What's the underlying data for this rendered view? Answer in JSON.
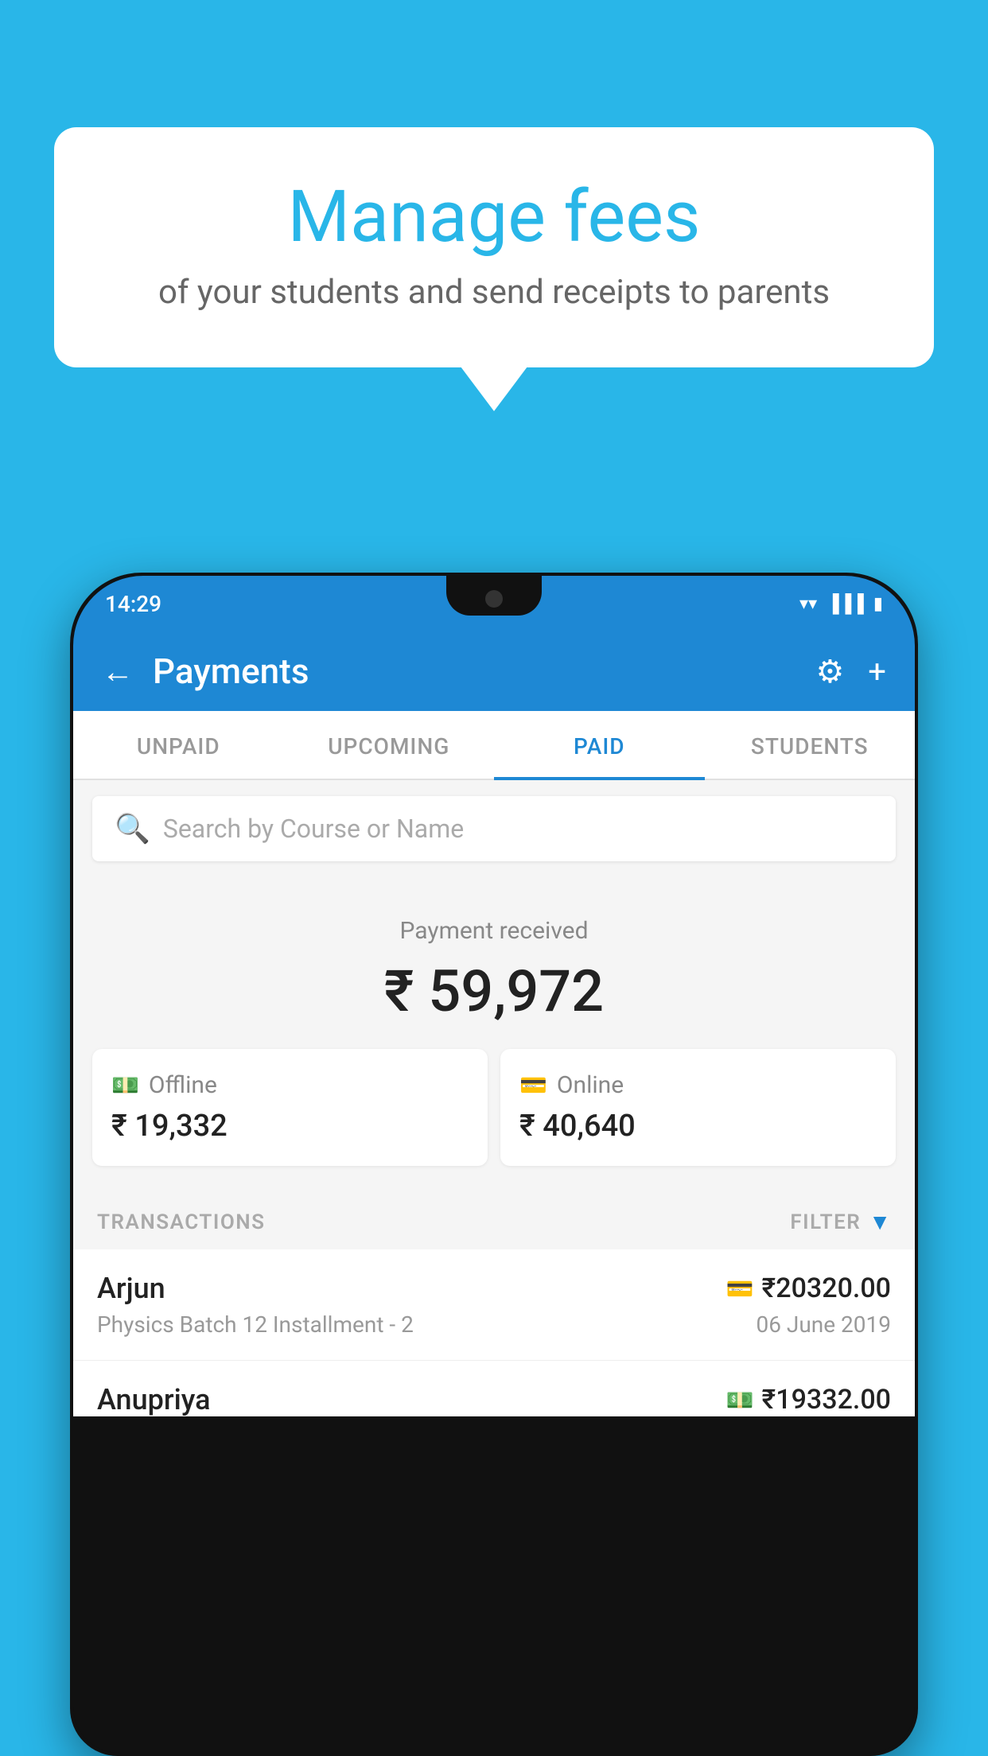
{
  "background_color": "#29b6e8",
  "speech_bubble": {
    "headline": "Manage fees",
    "subtext": "of your students and send receipts to parents"
  },
  "status_bar": {
    "time": "14:29",
    "icons": [
      "wifi",
      "signal",
      "battery"
    ]
  },
  "app_bar": {
    "title": "Payments",
    "back_icon": "←",
    "settings_icon": "⚙",
    "add_icon": "+"
  },
  "tabs": [
    {
      "label": "UNPAID",
      "active": false
    },
    {
      "label": "UPCOMING",
      "active": false
    },
    {
      "label": "PAID",
      "active": true
    },
    {
      "label": "STUDENTS",
      "active": false
    }
  ],
  "search": {
    "placeholder": "Search by Course or Name"
  },
  "payment_summary": {
    "label": "Payment received",
    "total": "₹ 59,972",
    "offline": {
      "label": "Offline",
      "amount": "₹ 19,332"
    },
    "online": {
      "label": "Online",
      "amount": "₹ 40,640"
    }
  },
  "transactions": {
    "header_label": "TRANSACTIONS",
    "filter_label": "FILTER",
    "items": [
      {
        "name": "Arjun",
        "detail": "Physics Batch 12 Installment - 2",
        "amount": "₹20320.00",
        "date": "06 June 2019",
        "payment_type": "card"
      },
      {
        "name": "Anupriya",
        "detail": "",
        "amount": "₹19332.00",
        "date": "",
        "payment_type": "cash"
      }
    ]
  }
}
